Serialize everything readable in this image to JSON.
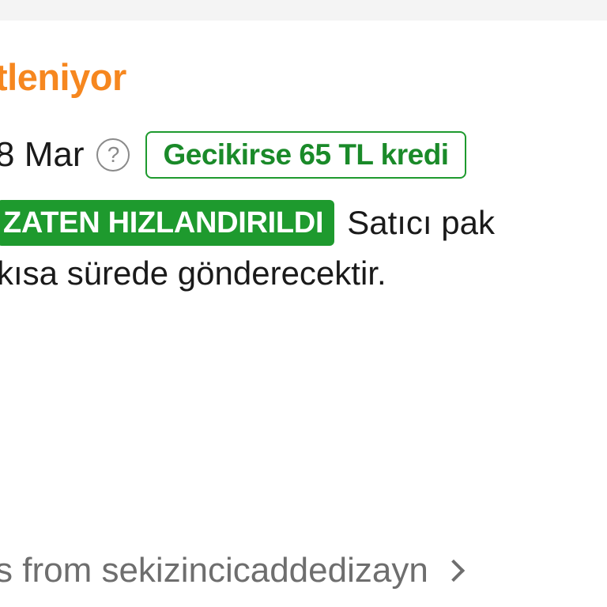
{
  "colors": {
    "status_orange": "#f6871f",
    "success_green": "#1e9a2e",
    "badge_text_green": "#1a8a29"
  },
  "order": {
    "status_title": "tleniyor",
    "delivery_date": "8 Mar",
    "help_icon": "question-circle-icon",
    "late_credit_badge": "Gecikirse 65 TL kredi",
    "speed_tag": "ZATEN HIZLANDIRILDI",
    "speed_text_line1": "Satıcı pak",
    "speed_text_line2": "kısa sürede gönderecektir."
  },
  "store": {
    "link_text": "s from sekizincicaddedizayn",
    "chevron_icon": "chevron-right-icon"
  }
}
